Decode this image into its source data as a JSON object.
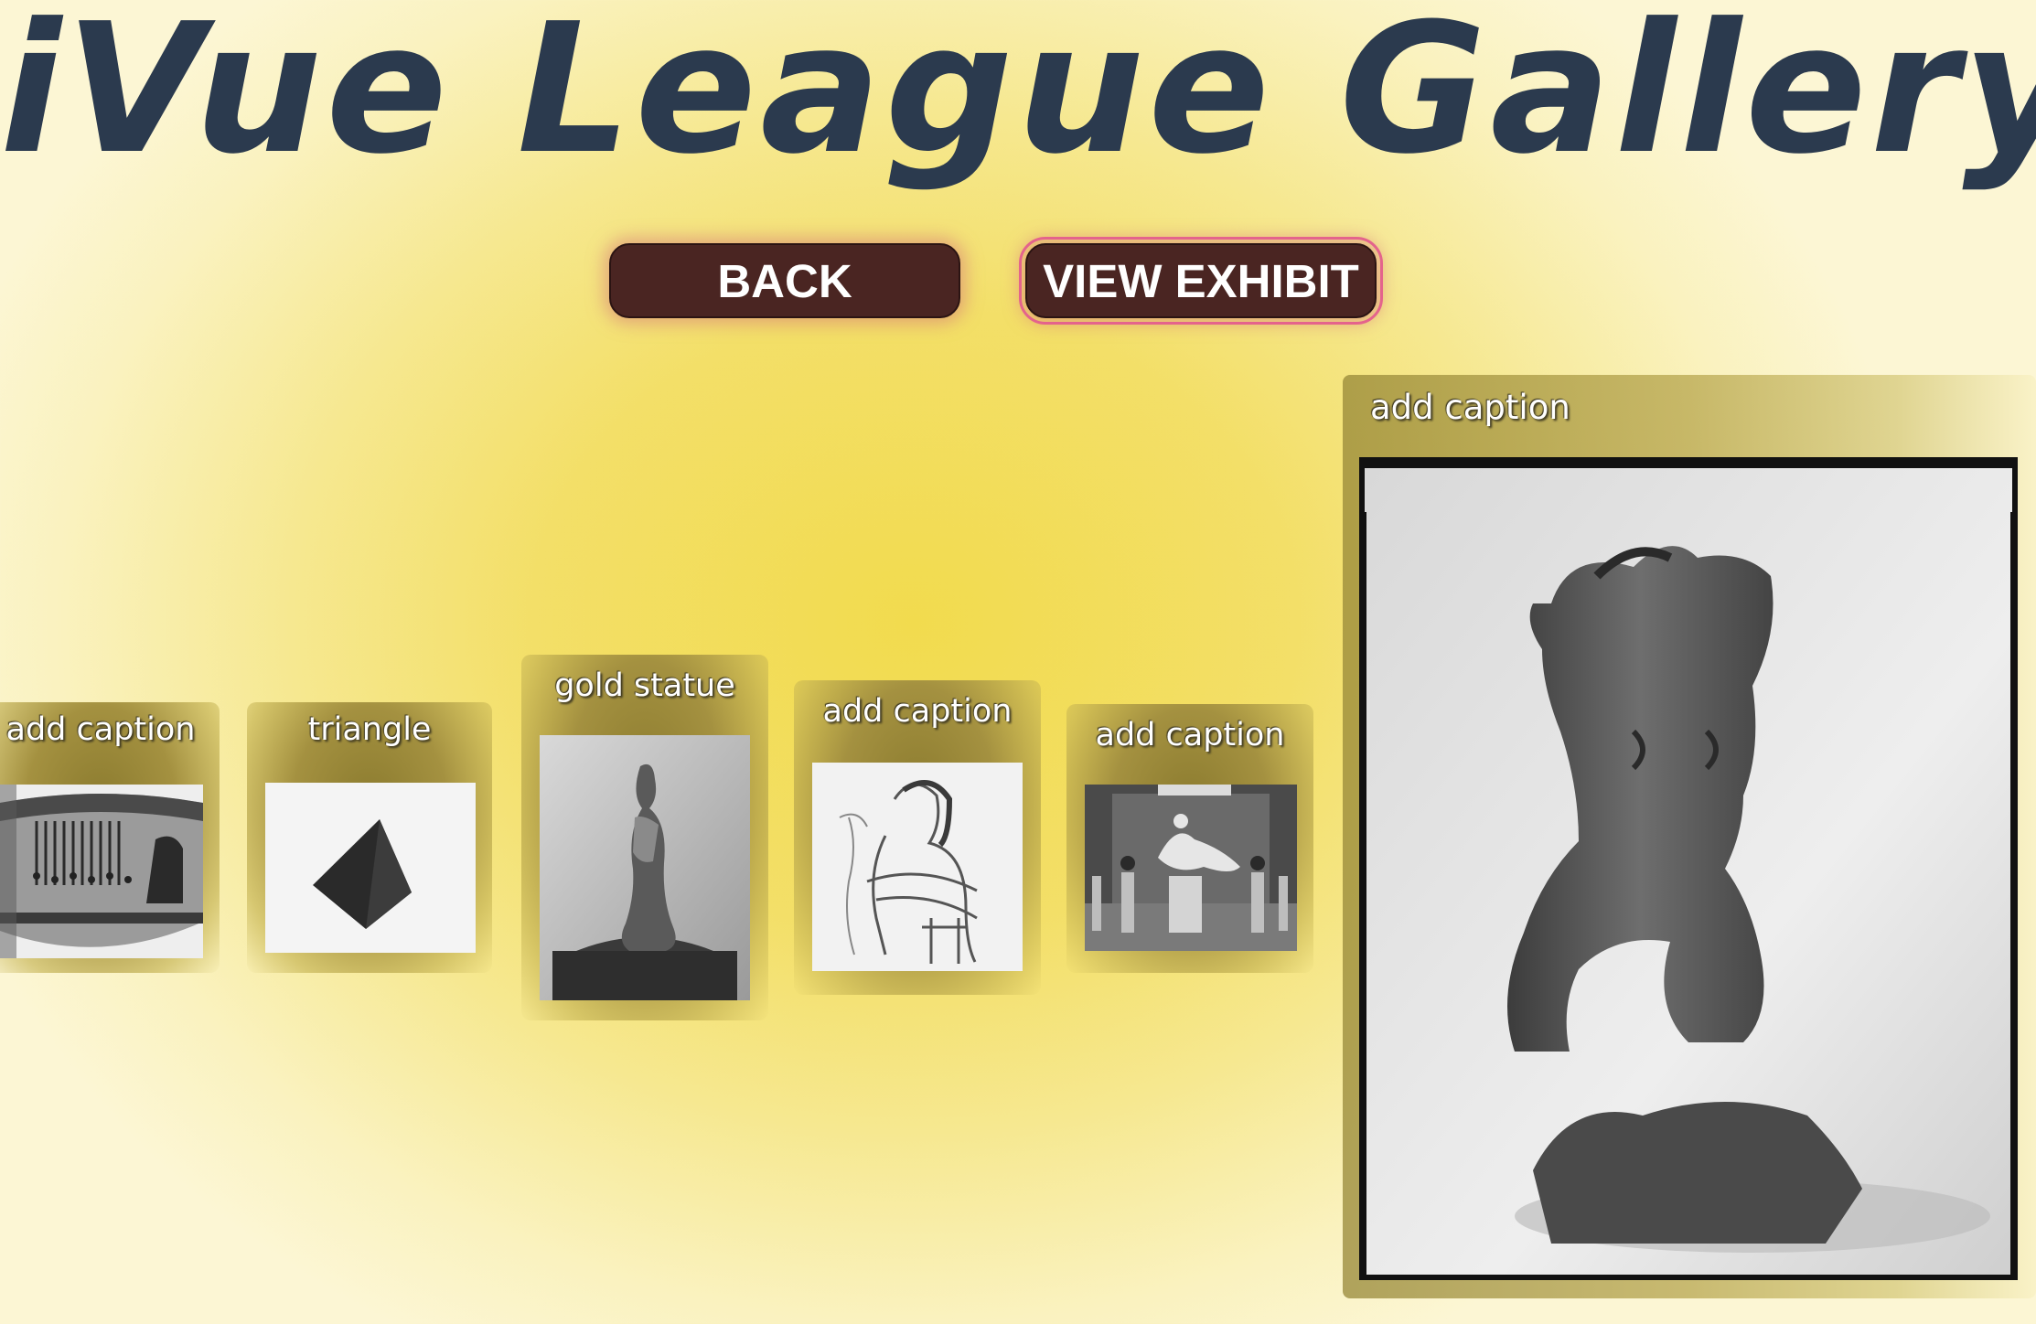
{
  "app": {
    "title": "iVue League Gallery"
  },
  "toolbar": {
    "back_label": "BACK",
    "view_exhibit_label": "VIEW EXHIBIT"
  },
  "gallery": {
    "items": [
      {
        "caption": "add caption",
        "image": "ancient vase with loom scene"
      },
      {
        "caption": "triangle",
        "image": "dark pyramid object"
      },
      {
        "caption": "gold statue",
        "image": "bronze female statuette"
      },
      {
        "caption": "add caption",
        "image": "sketch of seated figure"
      },
      {
        "caption": "add caption",
        "image": "gallery room with sculpture"
      }
    ],
    "featured": {
      "caption": "add caption",
      "image": "bronze female torso sculpture"
    }
  },
  "colors": {
    "title": "#2b3a4e",
    "button_bg": "#4a2522",
    "button_glow": "#d67878",
    "selection_outline": "#e4638c",
    "background_center": "#f2db4e",
    "background_edge": "#fcf6d4"
  }
}
